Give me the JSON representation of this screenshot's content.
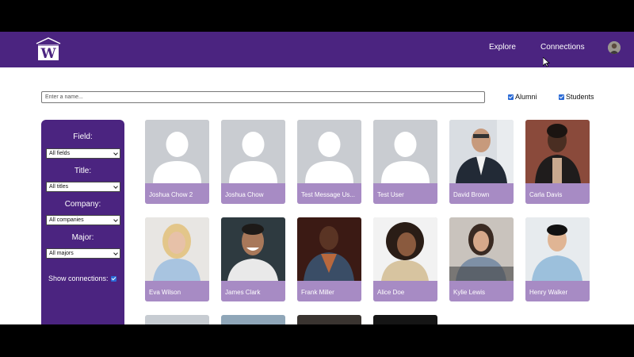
{
  "nav": {
    "links": [
      "Explore",
      "Connections"
    ]
  },
  "search": {
    "placeholder": "Enter a name..."
  },
  "toggles": {
    "alumni": "Alumni",
    "students": "Students"
  },
  "filters": {
    "field_label": "Field:",
    "field_value": "All fields",
    "title_label": "Title:",
    "title_value": "All titles",
    "company_label": "Company:",
    "company_value": "All companies",
    "major_label": "Major:",
    "major_value": "All majors",
    "show_connections": "Show connections:"
  },
  "people": [
    {
      "name": "Joshua Chow 2",
      "photo": "placeholder"
    },
    {
      "name": "Joshua Chow",
      "photo": "placeholder"
    },
    {
      "name": "Test Message Us...",
      "photo": "placeholder"
    },
    {
      "name": "Test User",
      "photo": "placeholder"
    },
    {
      "name": "David Brown",
      "photo": "photo"
    },
    {
      "name": "Carla Davis",
      "photo": "photo"
    },
    {
      "name": "Eva Wilson",
      "photo": "photo"
    },
    {
      "name": "James Clark",
      "photo": "photo"
    },
    {
      "name": "Frank Miller",
      "photo": "photo"
    },
    {
      "name": "Alice Doe",
      "photo": "photo"
    },
    {
      "name": "Kylie Lewis",
      "photo": "photo"
    },
    {
      "name": "Henry Walker",
      "photo": "photo"
    }
  ],
  "colors": {
    "brand": "#4b2480",
    "name_bar": "#a78bc4",
    "placeholder_bg": "#c9ccd1"
  }
}
